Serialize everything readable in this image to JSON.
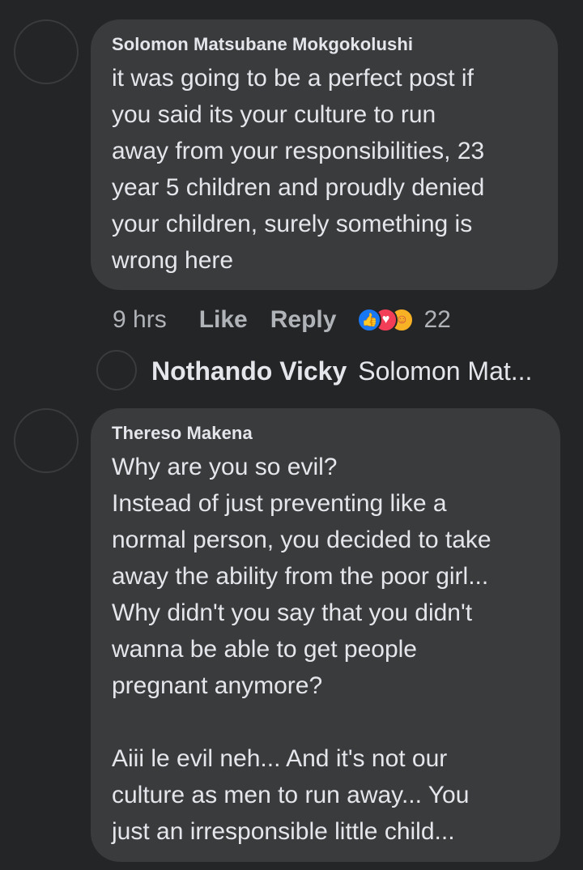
{
  "comments": [
    {
      "author": "Solomon Matsubane Mokgokolushi",
      "text": "it was going to be a perfect post if\nyou said its your culture to run\naway from your responsibilities, 23\nyear 5 children and proudly denied\nyour children, surely something is\nwrong here",
      "time": "9 hrs",
      "like_label": "Like",
      "reply_label": "Reply",
      "reaction_count": "22",
      "reactions": [
        "like-icon",
        "love-icon",
        "care-icon"
      ]
    },
    {
      "author": "Thereso Makena",
      "text": "Why are you so evil?\nInstead of just preventing like a\nnormal person, you decided to take\naway the ability from the poor girl...\nWhy didn't you say that you didn't\nwanna be able to get people\npregnant anymore?\n\nAiii le evil neh... And it's not our\nculture as men to run away... You\njust an irresponsible little child..."
    }
  ],
  "reply_preview": {
    "author": "Nothando Vicky",
    "text": "Solomon Mat..."
  },
  "colors": {
    "background": "#242526",
    "bubble": "#3a3b3c",
    "text": "#e4e6eb",
    "secondary": "#b0b3b8",
    "like": "#1877f2",
    "love": "#f33e58",
    "care": "#f7b125"
  }
}
